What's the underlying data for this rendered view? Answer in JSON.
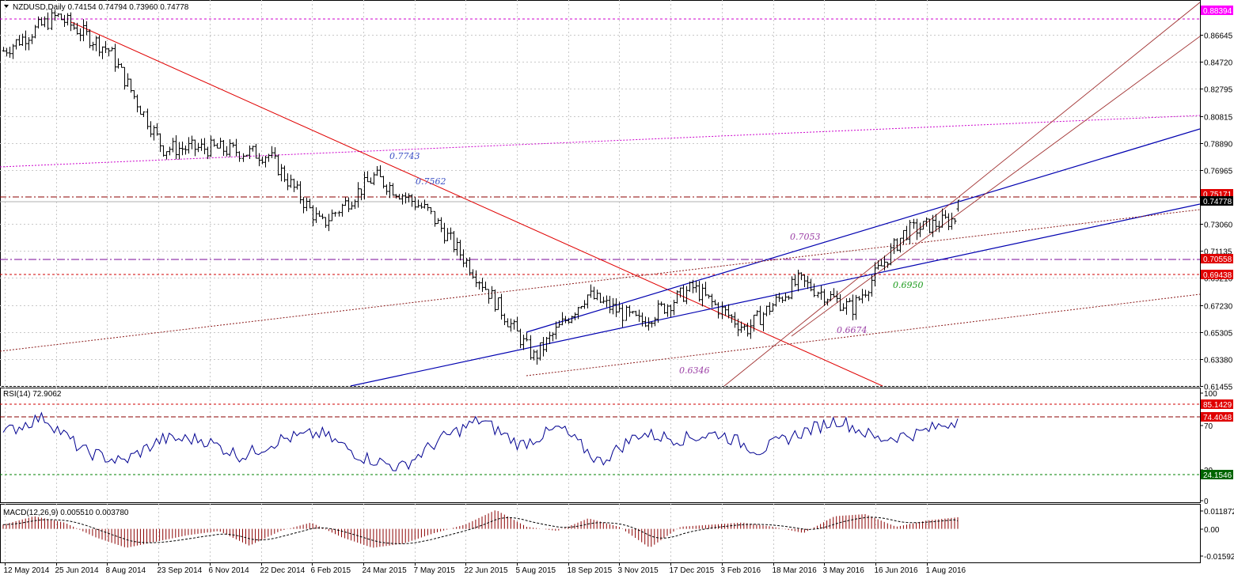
{
  "header": {
    "symbol_line": "NZDUSD,Daily  0.74154 0.74794 0.73960 0.74778",
    "rsi_label": "RSI(14) 72.9062",
    "macd_label": "MACD(12,26,9) 0.005510 0.003780"
  },
  "colors": {
    "background": "#ffffff",
    "grid": "#c8c8c8",
    "price_bars": "#000000",
    "trend_red": "#e00000",
    "channel_blue": "#0000b0",
    "dotted_brown": "#8b1a1a",
    "dashed_red": "#d00000",
    "dashdot_purple": "#7a0a9a",
    "magenta": "#cc00cc",
    "rsi_line": "#000090",
    "macd_hist": "#8b0000",
    "macd_signal": "#000000",
    "badge_red": "#e00000",
    "badge_black": "#000000",
    "badge_magenta": "#ff00ff",
    "badge_green": "#006400"
  },
  "price_axis": {
    "ticks": [
      "0.86645",
      "0.84720",
      "0.82795",
      "0.80815",
      "0.78890",
      "0.76965",
      "0.73060",
      "0.71135",
      "0.69210",
      "0.67230",
      "0.65305",
      "0.63380",
      "0.61455"
    ],
    "badges": [
      {
        "text": "0.88394",
        "color": "magenta"
      },
      {
        "text": "0.75171",
        "color": "red"
      },
      {
        "text": "0.74778",
        "color": "black"
      },
      {
        "text": "0.70558",
        "color": "red"
      },
      {
        "text": "0.69438",
        "color": "red"
      }
    ]
  },
  "rsi_axis": {
    "ticks": [
      "100",
      "70",
      "30",
      "0"
    ],
    "badges": [
      {
        "text": "85.1429",
        "color": "red"
      },
      {
        "text": "74.4048",
        "color": "red"
      },
      {
        "text": "24.1546",
        "color": "green"
      }
    ]
  },
  "macd_axis": {
    "ticks": [
      "0.011872",
      "0.00",
      "-0.015920"
    ]
  },
  "time_axis": {
    "ticks": [
      "12 May 2014",
      "25 Jun 2014",
      "8 Aug 2014",
      "23 Sep 2014",
      "6 Nov 2014",
      "22 Dec 2014",
      "6 Feb 2015",
      "24 Mar 2015",
      "7 May 2015",
      "22 Jun 2015",
      "5 Aug 2015",
      "18 Sep 2015",
      "3 Nov 2015",
      "17 Dec 2015",
      "3 Feb 2016",
      "18 Mar 2016",
      "3 May 2016",
      "16 Jun 2016",
      "1 Aug 2016"
    ]
  },
  "annotations": [
    {
      "text": "0.7743",
      "color": "blue"
    },
    {
      "text": "0.7562",
      "color": "blue"
    },
    {
      "text": "0.7053",
      "color": "purple"
    },
    {
      "text": "0.6950",
      "color": "green"
    },
    {
      "text": "0.6674",
      "color": "purple"
    },
    {
      "text": "0.6346",
      "color": "purple"
    }
  ],
  "chart_data": {
    "type": "line",
    "title": "NZDUSD,Daily",
    "x": [
      "12 May 2014",
      "25 Jun 2014",
      "8 Aug 2014",
      "23 Sep 2014",
      "6 Nov 2014",
      "22 Dec 2014",
      "6 Feb 2015",
      "24 Mar 2015",
      "7 May 2015",
      "22 Jun 2015",
      "5 Aug 2015",
      "18 Sep 2015",
      "3 Nov 2015",
      "17 Dec 2015",
      "3 Feb 2016",
      "18 Mar 2016",
      "3 May 2016",
      "16 Jun 2016",
      "1 Aug 2016"
    ],
    "series": [
      {
        "values": [
          0.855,
          0.88,
          0.855,
          0.785,
          0.785,
          0.78,
          0.73,
          0.765,
          0.74,
          0.69,
          0.635,
          0.68,
          0.66,
          0.685,
          0.655,
          0.69,
          0.67,
          0.725,
          0.735
        ]
      }
    ],
    "last_price": {
      "open": 0.74154,
      "high": 0.74794,
      "low": 0.7396,
      "close": 0.74778
    },
    "ylim": [
      0.6145,
      0.8914
    ],
    "rsi": {
      "period": 14,
      "last": 72.9062,
      "levels": [
        85.1429,
        74.4048,
        24.1546
      ],
      "ylim": [
        0,
        100
      ],
      "values": [
        60,
        75,
        45,
        35,
        55,
        55,
        40,
        55,
        60,
        40,
        30,
        55,
        72,
        50,
        65,
        35,
        60,
        55,
        60,
        45,
        60,
        72,
        55,
        60,
        72
      ]
    },
    "macd": {
      "fast": 12,
      "slow": 26,
      "signal": 9,
      "main": 0.00551,
      "signal_value": 0.00378,
      "ylim": [
        -0.01592,
        0.011872
      ],
      "values": [
        0.002,
        0.006,
        0.003,
        -0.004,
        -0.009,
        -0.006,
        -0.003,
        -0.001,
        -0.008,
        -0.001,
        0.003,
        -0.004,
        -0.009,
        -0.007,
        -0.002,
        0.002,
        0.009,
        0.001,
        -0.001,
        0.005,
        0.001,
        -0.009,
        0.001,
        0.002,
        0.003,
        0.001,
        -0.002,
        0.006,
        0.007,
        0.001,
        0.004,
        0.0055
      ]
    }
  }
}
